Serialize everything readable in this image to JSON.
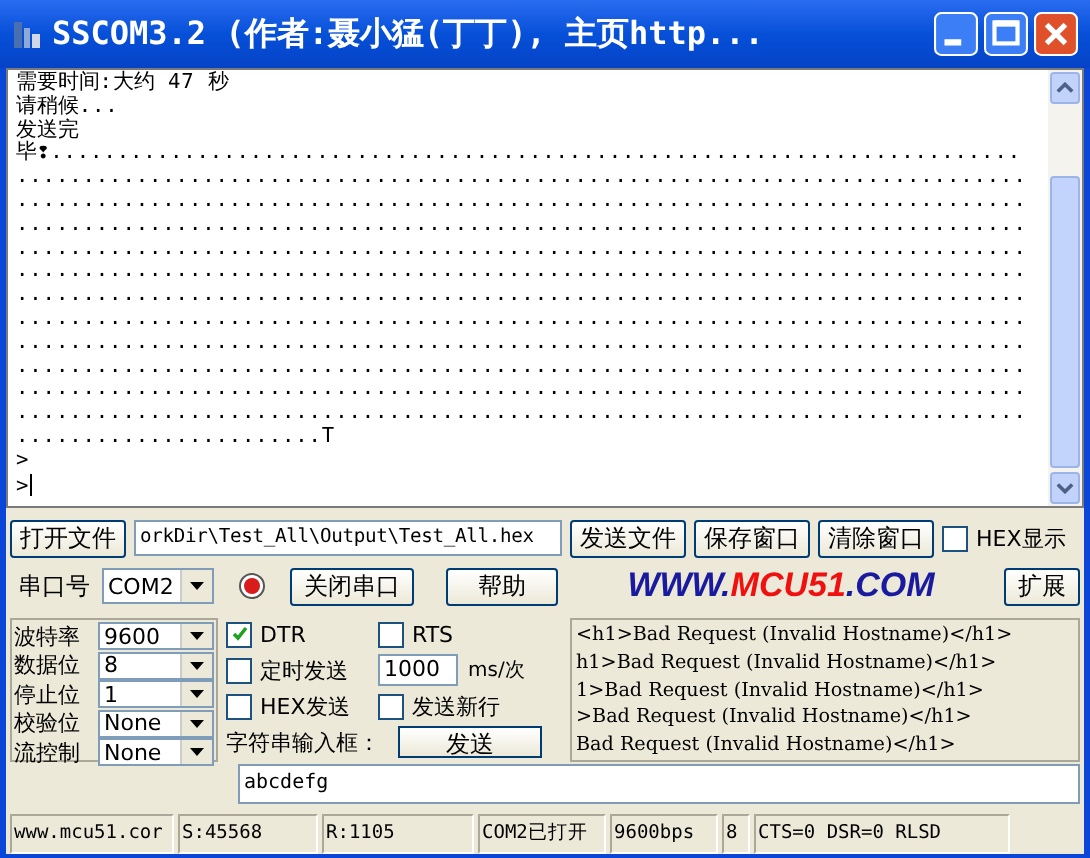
{
  "window": {
    "title": "SSCOM3.2 (作者:聂小猛(丁丁), 主页http..."
  },
  "output": {
    "lines": [
      "需要时间:大约 47 秒",
      "请稍候...",
      "发送完",
      "毕❢.........................................................................",
      "............................................................................",
      "............................................................................",
      "............................................................................",
      "............................................................................",
      "............................................................................",
      "............................................................................",
      "............................................................................",
      "............................................................................",
      "............................................................................",
      "............................................................................",
      "............................................................................",
      ".......................T"
    ],
    "prompts": [
      ">",
      ">"
    ]
  },
  "file_row": {
    "open_button": "打开文件",
    "path": "orkDir\\Test_All\\Output\\Test_All.hex",
    "buttons": [
      "发送文件",
      "保存窗口",
      "清除窗口"
    ],
    "hex_display": {
      "label": "HEX显示",
      "checked": false
    }
  },
  "port_row": {
    "label": "串口号",
    "port": "COM2",
    "close_button": "关闭串口",
    "help_button": "帮助",
    "logo_parts": [
      "WWW.",
      "MCU51",
      ".COM"
    ],
    "expand_button": "扩展"
  },
  "settings": [
    {
      "label": "波特率",
      "value": "9600"
    },
    {
      "label": "数据位",
      "value": "8"
    },
    {
      "label": "停止位",
      "value": "1"
    },
    {
      "label": "校验位",
      "value": "None"
    },
    {
      "label": "流控制",
      "value": "None"
    }
  ],
  "options": [
    {
      "label": "DTR",
      "checked": true
    },
    {
      "label": "RTS",
      "checked": false
    },
    {
      "label": "定时发送",
      "checked": false
    },
    {
      "label": "HEX发送",
      "checked": false
    },
    {
      "label": "发送新行",
      "checked": false
    }
  ],
  "interval": {
    "value": "1000",
    "unit": "ms/次"
  },
  "send": {
    "label": "字符串输入框：",
    "button": "发送",
    "value": "abcdefg"
  },
  "history": [
    "<h1>Bad Request (Invalid Hostname)</h1>",
    "h1>Bad Request (Invalid Hostname)</h1>",
    "1>Bad Request (Invalid Hostname)</h1>",
    ">Bad Request (Invalid Hostname)</h1>",
    "Bad Request (Invalid Hostname)</h1>"
  ],
  "status_bar": [
    "www.mcu51.cor",
    "S:45568",
    "R:1105",
    "COM2已打开",
    "9600bps",
    "8",
    "CTS=0 DSR=0 RLSD"
  ]
}
